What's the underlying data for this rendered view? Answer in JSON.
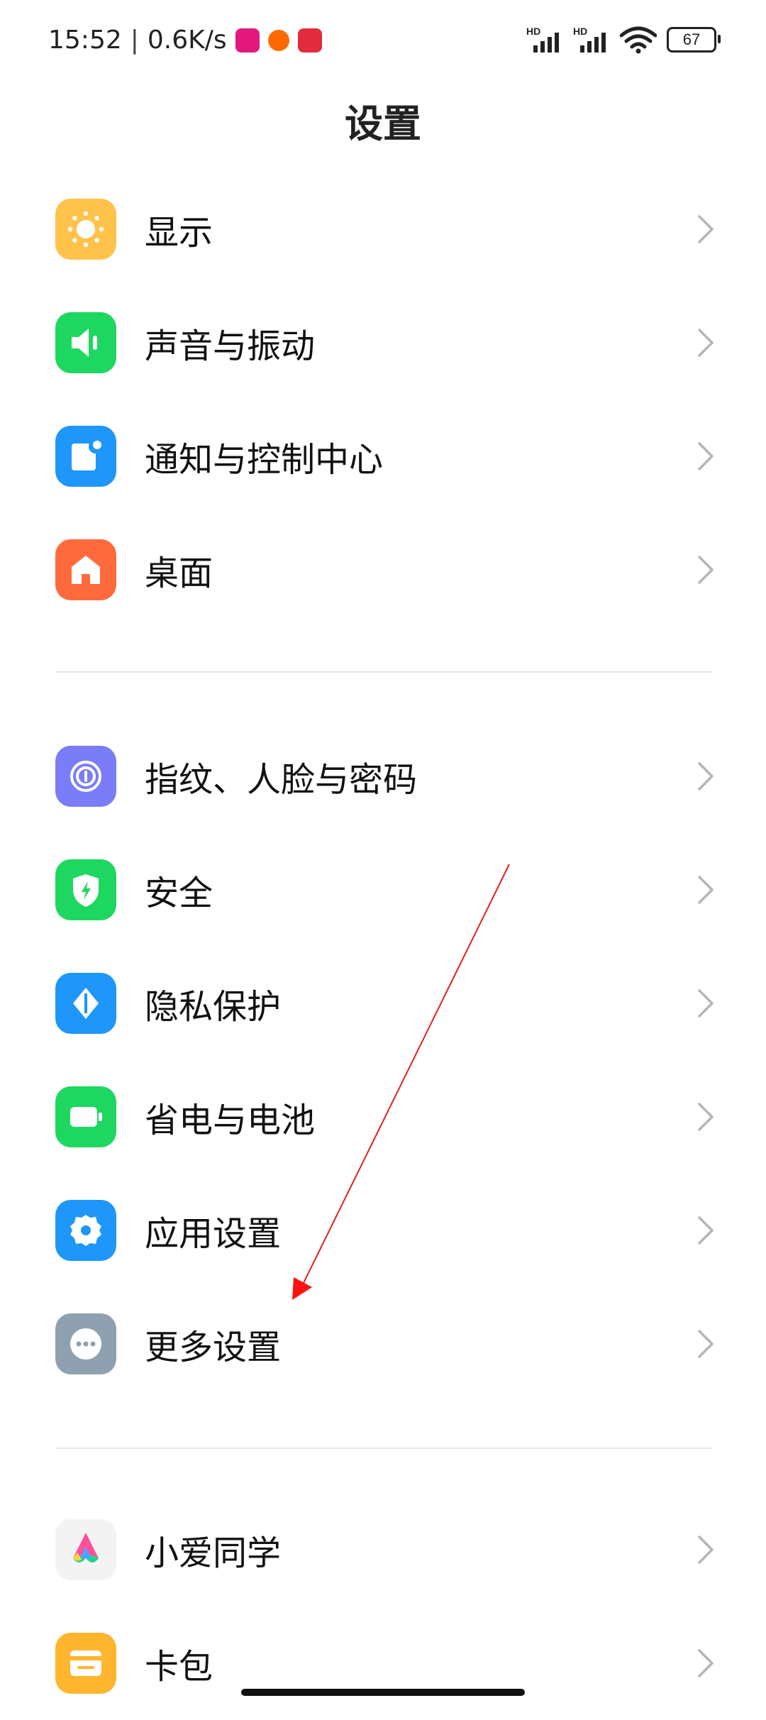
{
  "status_bar": {
    "time": "15:52",
    "separator": "|",
    "speed": "0.6K/s",
    "signal_label_1": "HD",
    "signal_label_2": "HD",
    "battery": "67"
  },
  "header": {
    "title": "设置"
  },
  "group1": [
    {
      "label": "显示",
      "icon": "sun-icon",
      "color": "#FFC24A"
    },
    {
      "label": "声音与振动",
      "icon": "speaker-icon",
      "color": "#1ED760"
    },
    {
      "label": "通知与控制中心",
      "icon": "notification-icon",
      "color": "#1E96FA"
    },
    {
      "label": "桌面",
      "icon": "home-icon",
      "color": "#FF6A3D"
    }
  ],
  "group2": [
    {
      "label": "指纹、人脸与密码",
      "icon": "fingerprint-icon",
      "color": "#7B7CF7"
    },
    {
      "label": "安全",
      "icon": "shield-icon",
      "color": "#1ED760"
    },
    {
      "label": "隐私保护",
      "icon": "privacy-icon",
      "color": "#1E96FA"
    },
    {
      "label": "省电与电池",
      "icon": "battery-icon",
      "color": "#1ED760"
    },
    {
      "label": "应用设置",
      "icon": "gear-icon",
      "color": "#1E96FA"
    },
    {
      "label": "更多设置",
      "icon": "more-icon",
      "color": "#8FA1B0"
    }
  ],
  "group3": [
    {
      "label": "小爱同学",
      "icon": "xiaoai-icon",
      "color": "#F3F3F3"
    },
    {
      "label": "卡包",
      "icon": "wallet-icon",
      "color": "#FFB52E"
    }
  ]
}
